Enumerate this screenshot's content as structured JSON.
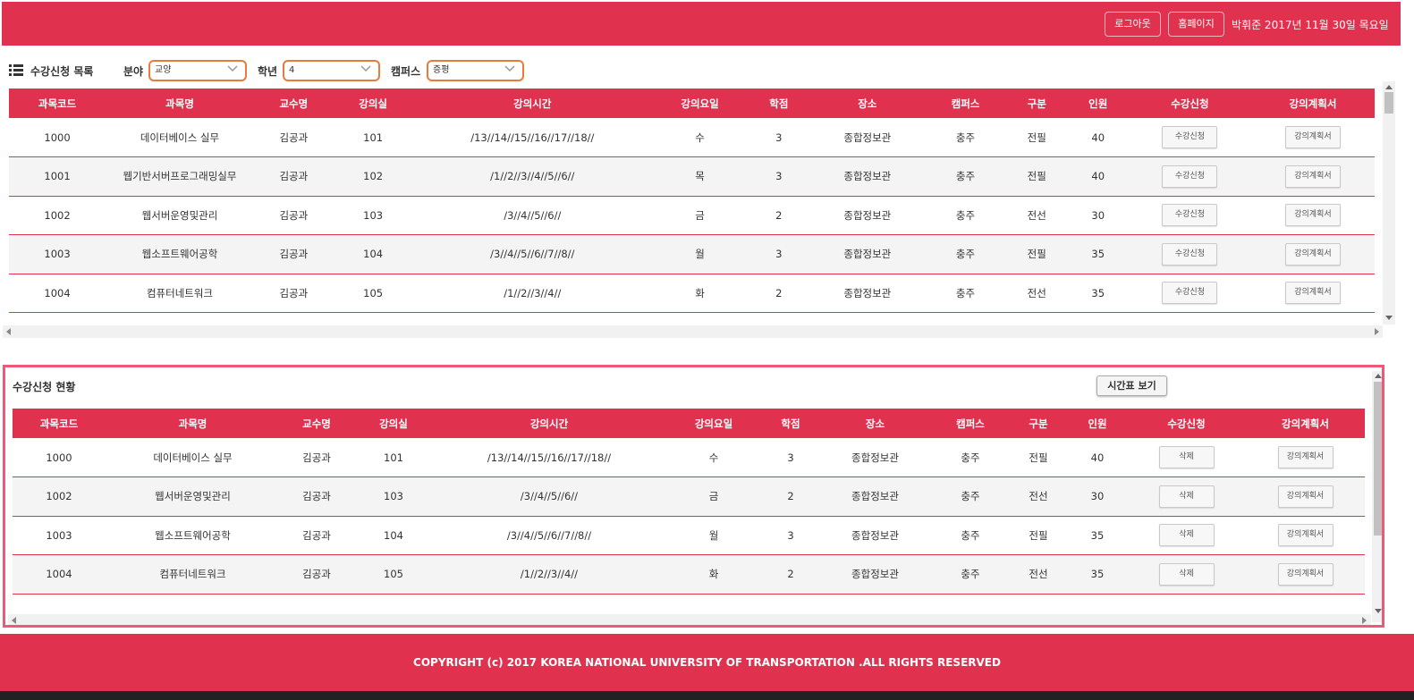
{
  "header": {
    "logout_label": "로그아웃",
    "homepage_label": "홈페이지",
    "user_info": "박휘준 2017년 11월 30일 목요일"
  },
  "filters": {
    "title": "수강신청 목록",
    "field_label": "분야",
    "field_value": "교양",
    "grade_label": "학년",
    "grade_value": "4",
    "campus_label": "캠퍼스",
    "campus_value": "증평"
  },
  "columns": [
    "과목코드",
    "과목명",
    "교수명",
    "강의실",
    "강의시간",
    "강의요일",
    "학점",
    "장소",
    "캠퍼스",
    "구분",
    "인원",
    "수강신청",
    "강의계획서"
  ],
  "course_list": {
    "action_label": "수강신청",
    "plan_label": "강의계획서",
    "rows": [
      {
        "code": "1000",
        "name": "데이터베이스 실무",
        "prof": "김공과",
        "room": "101",
        "time": "/13//14//15//16//17//18//",
        "day": "수",
        "credit": "3",
        "place": "종합정보관",
        "campus": "충주",
        "type": "전필",
        "count": "40"
      },
      {
        "code": "1001",
        "name": "웹기반서버프로그래밍실무",
        "prof": "김공과",
        "room": "102",
        "time": "/1//2//3//4//5//6//",
        "day": "목",
        "credit": "3",
        "place": "종합정보관",
        "campus": "충주",
        "type": "전필",
        "count": "40"
      },
      {
        "code": "1002",
        "name": "웹서버운영및관리",
        "prof": "김공과",
        "room": "103",
        "time": "/3//4//5//6//",
        "day": "금",
        "credit": "2",
        "place": "종합정보관",
        "campus": "충주",
        "type": "전선",
        "count": "30"
      },
      {
        "code": "1003",
        "name": "웹소프트웨어공학",
        "prof": "김공과",
        "room": "104",
        "time": "/3//4//5//6//7//8//",
        "day": "월",
        "credit": "3",
        "place": "종합정보관",
        "campus": "충주",
        "type": "전필",
        "count": "35"
      },
      {
        "code": "1004",
        "name": "컴퓨터네트워크",
        "prof": "김공과",
        "room": "105",
        "time": "/1//2//3//4//",
        "day": "화",
        "credit": "2",
        "place": "종합정보관",
        "campus": "충주",
        "type": "전선",
        "count": "35"
      }
    ]
  },
  "enrollment": {
    "title": "수강신청 현황",
    "timetable_label": "시간표 보기",
    "action_label": "삭제",
    "plan_label": "강의계획서",
    "rows": [
      {
        "code": "1000",
        "name": "데이터베이스 실무",
        "prof": "김공과",
        "room": "101",
        "time": "/13//14//15//16//17//18//",
        "day": "수",
        "credit": "3",
        "place": "종합정보관",
        "campus": "충주",
        "type": "전필",
        "count": "40"
      },
      {
        "code": "1002",
        "name": "웹서버운영및관리",
        "prof": "김공과",
        "room": "103",
        "time": "/3//4//5//6//",
        "day": "금",
        "credit": "2",
        "place": "종합정보관",
        "campus": "충주",
        "type": "전선",
        "count": "30"
      },
      {
        "code": "1003",
        "name": "웹소프트웨어공학",
        "prof": "김공과",
        "room": "104",
        "time": "/3//4//5//6//7//8//",
        "day": "월",
        "credit": "3",
        "place": "종합정보관",
        "campus": "충주",
        "type": "전필",
        "count": "35"
      },
      {
        "code": "1004",
        "name": "컴퓨터네트워크",
        "prof": "김공과",
        "room": "105",
        "time": "/1//2//3//4//",
        "day": "화",
        "credit": "2",
        "place": "종합정보관",
        "campus": "충주",
        "type": "전선",
        "count": "35"
      }
    ]
  },
  "footer": {
    "copyright": "COPYRIGHT (c) 2017 KOREA NATIONAL UNIVERSITY OF TRANSPORTATION .ALL RIGHTS RESERVED"
  },
  "colors": {
    "brand": "#e0314e",
    "panel_border": "#f0587a",
    "select_border": "#e87a3a"
  }
}
